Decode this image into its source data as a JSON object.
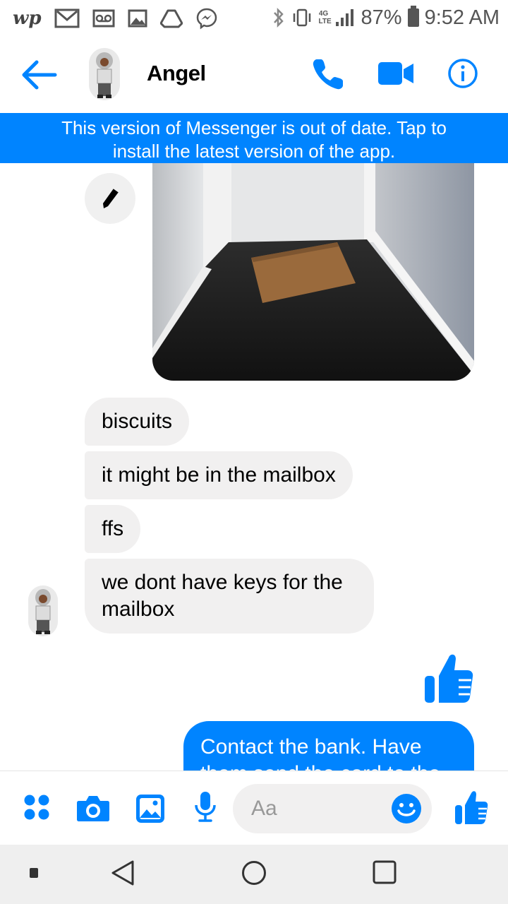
{
  "status_bar": {
    "left_icons": [
      "washington-post-icon",
      "gmail-icon",
      "voicemail-icon",
      "image-icon",
      "drive-icon",
      "messenger-icon"
    ],
    "wp_logo": "wp",
    "network": "4G LTE",
    "battery": "87%",
    "time": "9:52 AM"
  },
  "header": {
    "contact_name": "Angel",
    "accent_color": "#0084ff"
  },
  "banner": {
    "text": "This version of Messenger is out of date. Tap to install the latest version of the app."
  },
  "messages": {
    "received": [
      "biscuits",
      "it might be in the mailbox",
      "ffs",
      "we dont have keys for the mailbox"
    ],
    "sent": "Contact the bank. Have them send the card to the"
  },
  "composer": {
    "placeholder": "Aa"
  },
  "colors": {
    "accent": "#0084ff",
    "incoming_bubble": "#f1f0f0",
    "banner": "#0084ff"
  }
}
